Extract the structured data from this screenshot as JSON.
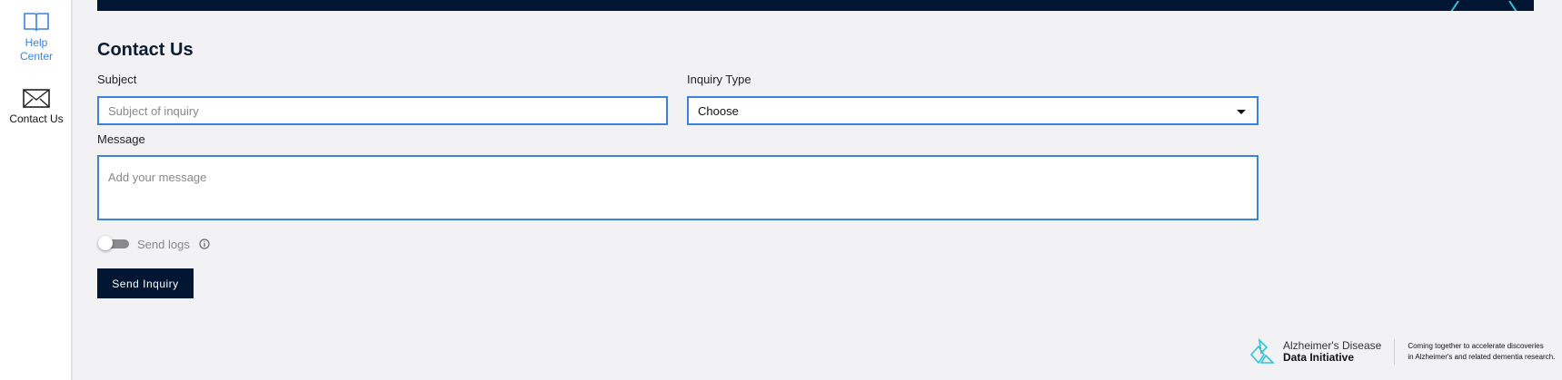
{
  "sidebar": {
    "items": [
      {
        "label1": "Help",
        "label2": "Center",
        "icon": "book-icon"
      },
      {
        "label": "Contact Us",
        "icon": "envelope-icon"
      }
    ]
  },
  "page": {
    "title": "Contact Us"
  },
  "form": {
    "subject_label": "Subject",
    "subject_placeholder": "Subject of inquiry",
    "inquiry_label": "Inquiry Type",
    "inquiry_value": "Choose",
    "message_label": "Message",
    "message_placeholder": "Add your message",
    "send_logs_label": "Send logs",
    "send_logs_on": false,
    "submit_label": "Send Inquiry"
  },
  "footer": {
    "brand_line1": "Alzheimer's Disease",
    "brand_line2": "Data Initiative",
    "tagline1": "Coming together to accelerate discoveries",
    "tagline2": "in Alzheimer's and related dementia research."
  },
  "colors": {
    "navy": "#001633",
    "accent": "#3b82dc",
    "teal": "#2ec4d6"
  }
}
